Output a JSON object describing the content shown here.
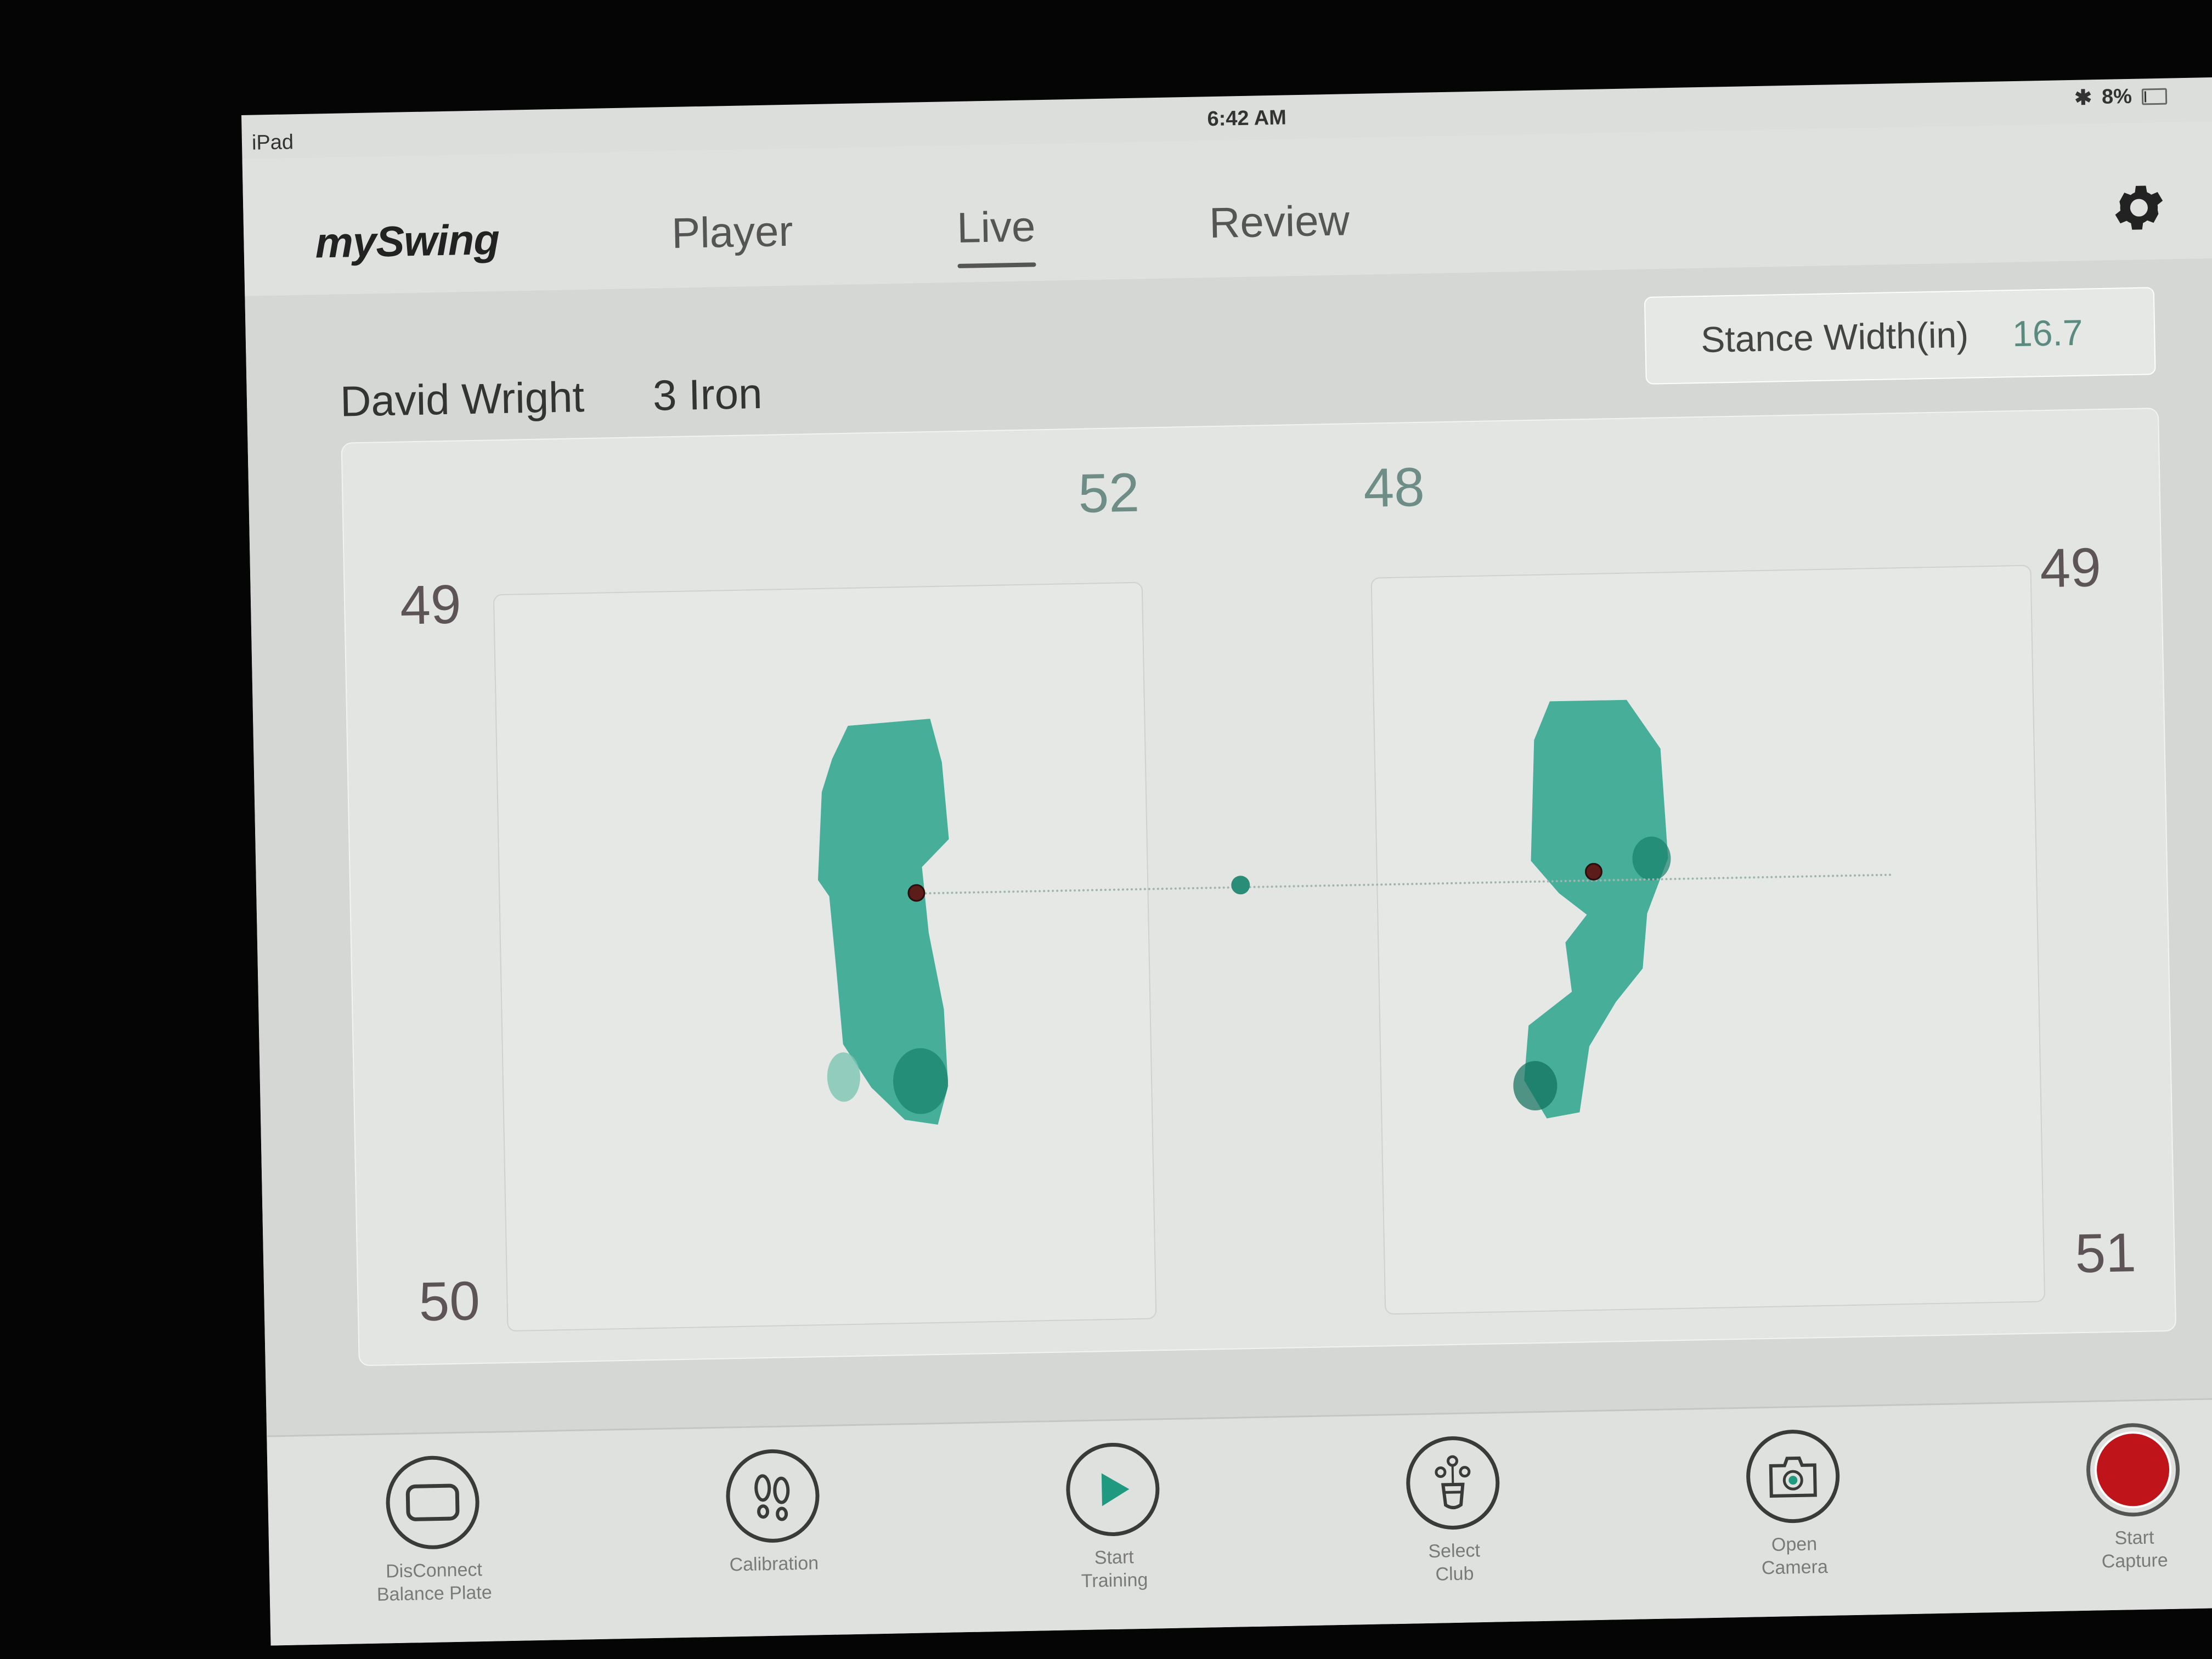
{
  "status_bar": {
    "device": "iPad",
    "time": "6:42 AM",
    "bluetooth_icon": "bluetooth-icon",
    "battery_percent": "8%",
    "battery_level": 0.08
  },
  "app": {
    "logo": "mySwing",
    "tabs": [
      {
        "label": "Player",
        "active": false
      },
      {
        "label": "Live",
        "active": true
      },
      {
        "label": "Review",
        "active": false
      }
    ],
    "settings_icon": "gear-icon"
  },
  "session": {
    "player_name": "David Wright",
    "club": "3 Iron",
    "stance_width_label": "Stance Width(in)",
    "stance_width_value": "16.7"
  },
  "balance": {
    "left_weight_pct": "52",
    "right_weight_pct": "48",
    "left_plate": {
      "top_value": "49",
      "bottom_value": "50"
    },
    "right_plate": {
      "top_value": "49",
      "bottom_value": "51"
    },
    "heatmap_color": "#2aa58c",
    "cop_color": "#5b1c1a"
  },
  "toolbar": [
    {
      "label": "DisConnect\nBalance Plate",
      "icon": "balance-plate-icon"
    },
    {
      "label": "Calibration",
      "icon": "footprints-icon"
    },
    {
      "label": "Start\nTraining",
      "icon": "play-icon"
    },
    {
      "label": "Select\nClub",
      "icon": "golf-bag-icon"
    },
    {
      "label": "Open\nCamera",
      "icon": "camera-icon"
    },
    {
      "label": "Start\nCapture",
      "icon": "record-icon"
    }
  ],
  "colors": {
    "accent_teal": "#1f9a80",
    "record_red": "#c0141b"
  }
}
